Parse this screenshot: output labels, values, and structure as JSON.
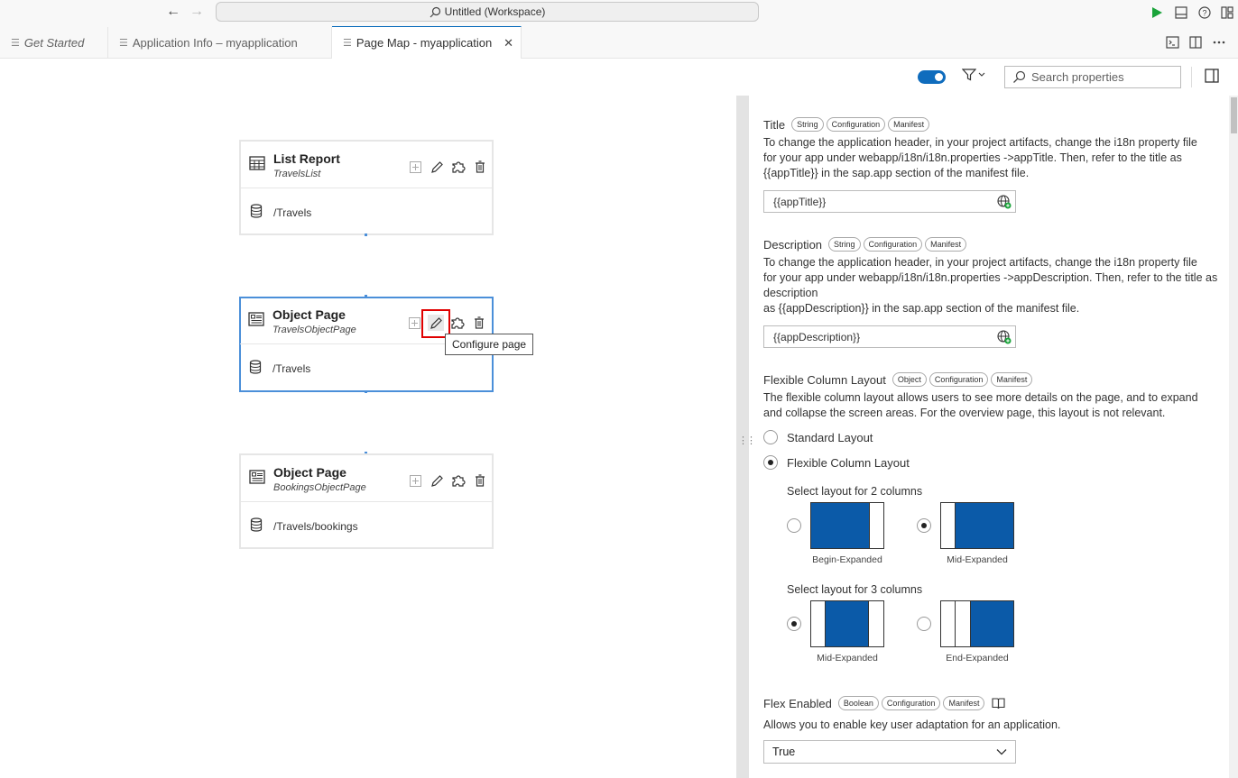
{
  "titlebar": {
    "workspace_title": "Untitled (Workspace)"
  },
  "tabs": [
    {
      "label": "Get Started"
    },
    {
      "label": "Application Info – myapplication"
    },
    {
      "label": "Page Map - myapplication"
    }
  ],
  "canvas": {
    "cards": [
      {
        "title": "List Report",
        "subtitle": "TravelsList",
        "entity": "/Travels"
      },
      {
        "title": "Object Page",
        "subtitle": "TravelsObjectPage",
        "entity": "/Travels"
      },
      {
        "title": "Object Page",
        "subtitle": "BookingsObjectPage",
        "entity": "/Travels/bookings"
      }
    ],
    "tooltip": "Configure page"
  },
  "toolbar": {
    "search_placeholder": "Search properties"
  },
  "properties": {
    "title": {
      "name": "Title",
      "badges": [
        "String",
        "Configuration",
        "Manifest"
      ],
      "desc1": "To change the application header, in your project artifacts, change the i18n property file",
      "desc2": "for your app under webapp/i18n/i18n.properties ->appTitle. Then, refer to the title as",
      "desc3": "{{appTitle}} in the sap.app section of the manifest file.",
      "value": "{{appTitle}}"
    },
    "description": {
      "name": "Description",
      "badges": [
        "String",
        "Configuration",
        "Manifest"
      ],
      "desc1": "To change the application header, in your project artifacts, change the i18n property file",
      "desc2": "for your app under webapp/i18n/i18n.properties ->appDescription. Then, refer to the title as",
      "desc3": "description",
      "desc4": "as {{appDescription}} in the sap.app section of the manifest file.",
      "value": "{{appDescription}}"
    },
    "fcl": {
      "name": "Flexible Column Layout",
      "badges": [
        "Object",
        "Configuration",
        "Manifest"
      ],
      "desc1": "The flexible column layout allows users to see more details on the page, and to expand",
      "desc2": "and collapse the screen areas. For the overview page, this layout is not relevant.",
      "option_standard": "Standard Layout",
      "option_flexible": "Flexible Column Layout",
      "two_col_label": "Select layout for 2 columns",
      "two_col_options": [
        "Begin-Expanded",
        "Mid-Expanded"
      ],
      "three_col_label": "Select layout for 3 columns",
      "three_col_options": [
        "Mid-Expanded",
        "End-Expanded"
      ]
    },
    "flex_enabled": {
      "name": "Flex Enabled",
      "badges": [
        "Boolean",
        "Configuration",
        "Manifest"
      ],
      "desc": "Allows you to enable key user adaptation for an application.",
      "value": "True"
    }
  },
  "colors": {
    "accent": "#0f6cbd",
    "tile_blue": "#0b5aa8",
    "highlight": "#e00000",
    "run_green": "#1aa33a"
  }
}
